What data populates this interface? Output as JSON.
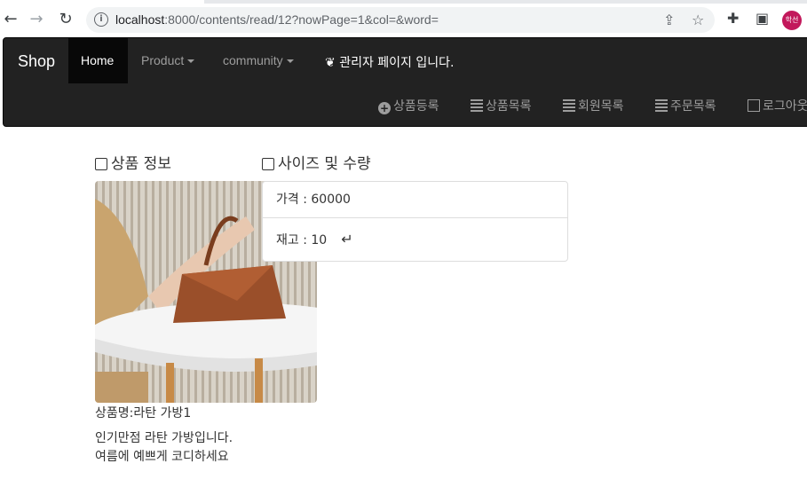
{
  "browser": {
    "url_host": "localhost",
    "url_rest": ":8000/contents/read/12?nowPage=1&col=&word=",
    "profile_label": "학선",
    "icons": [
      "back-arrow-icon",
      "forward-arrow-icon",
      "reload-icon",
      "info-icon",
      "share-icon",
      "star-icon",
      "extensions-icon",
      "sidepanel-icon"
    ]
  },
  "navbar": {
    "brand": "Shop",
    "home": "Home",
    "product": "Product",
    "community": "community",
    "admin": "관리자 페이지 입니다.",
    "right_links": [
      {
        "label": "상품등록",
        "icon": "plus-circle-icon"
      },
      {
        "label": "상품목록",
        "icon": "list-icon"
      },
      {
        "label": "회원목록",
        "icon": "list-icon"
      },
      {
        "label": "주문목록",
        "icon": "list-icon"
      },
      {
        "label": "로그아웃",
        "icon": "logout-icon"
      }
    ]
  },
  "product": {
    "section_title": "상품 정보",
    "name": "상품명:라탄 가방1",
    "description": "인기만점 라탄 가방입니다. 여름에 예쁘게 코디하세요"
  },
  "options": {
    "section_title": "사이즈 및 수량",
    "price_text": "가격 : 60000",
    "stock_text": "재고 : 10",
    "enter_icon": "↵"
  }
}
